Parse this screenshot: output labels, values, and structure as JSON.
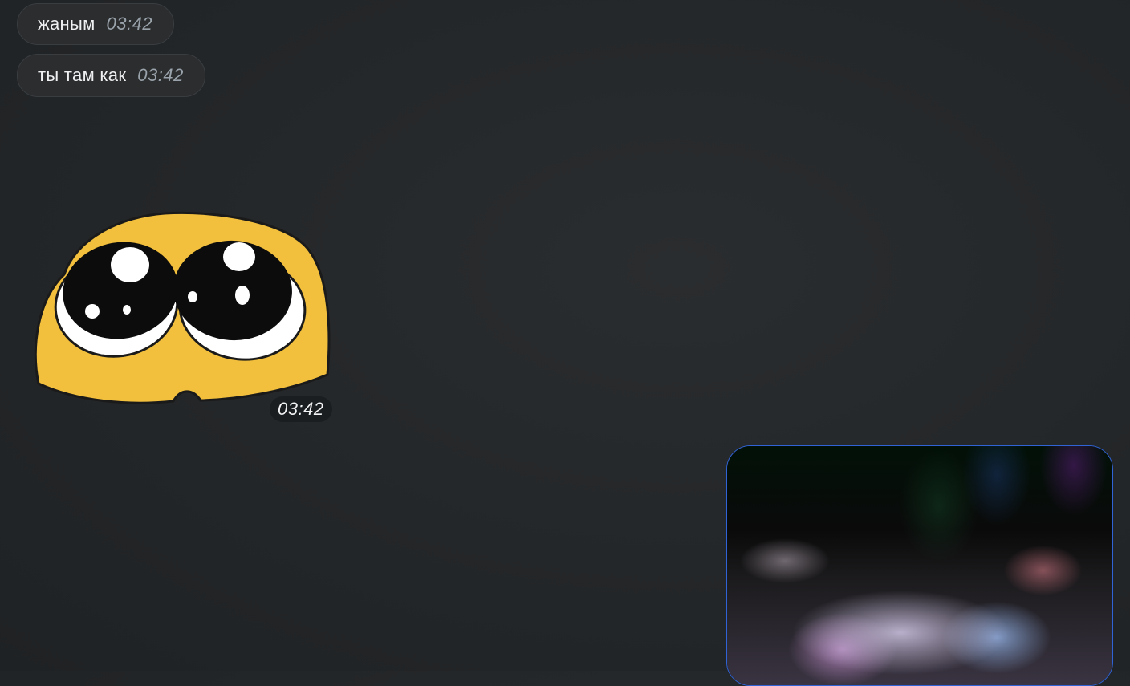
{
  "messages": [
    {
      "text": "жаным",
      "time": "03:42"
    },
    {
      "text": "ты там как",
      "time": "03:42"
    }
  ],
  "sticker": {
    "time": "03:42",
    "icon": "pleading-face-sticker-icon"
  },
  "media": {
    "icon": "blurred-photo-preview"
  },
  "colors": {
    "sticker_yellow": "#f3c03d",
    "media_border": "#2f63d6",
    "bubble_bg": "#2b2d2f"
  }
}
